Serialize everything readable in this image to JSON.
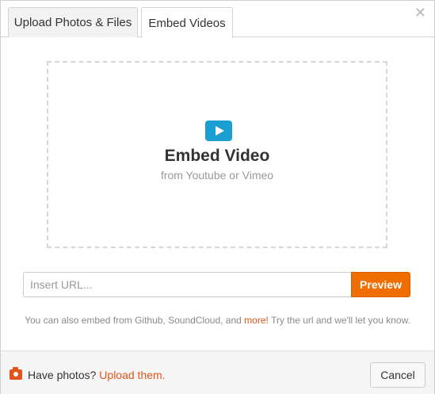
{
  "tabs": [
    {
      "label": "Upload Photos & Files",
      "active": false
    },
    {
      "label": "Embed Videos",
      "active": true
    }
  ],
  "close_icon": "close-icon",
  "dropzone": {
    "icon": "play-video-icon",
    "title": "Embed Video",
    "subtitle": "from Youtube or Vimeo"
  },
  "url": {
    "value": "",
    "placeholder": "Insert URL...",
    "preview_label": "Preview"
  },
  "hint": {
    "before": "You can also embed from Github, SoundCloud, and ",
    "link": "more!",
    "after": " Try the url and we'll let you know."
  },
  "footer": {
    "icon": "camera-icon",
    "text": "Have photos?",
    "link": "Upload them.",
    "cancel_label": "Cancel"
  },
  "colors": {
    "accent": "#f06d00",
    "link": "#e2531a",
    "play_icon": "#1b9ed1"
  }
}
